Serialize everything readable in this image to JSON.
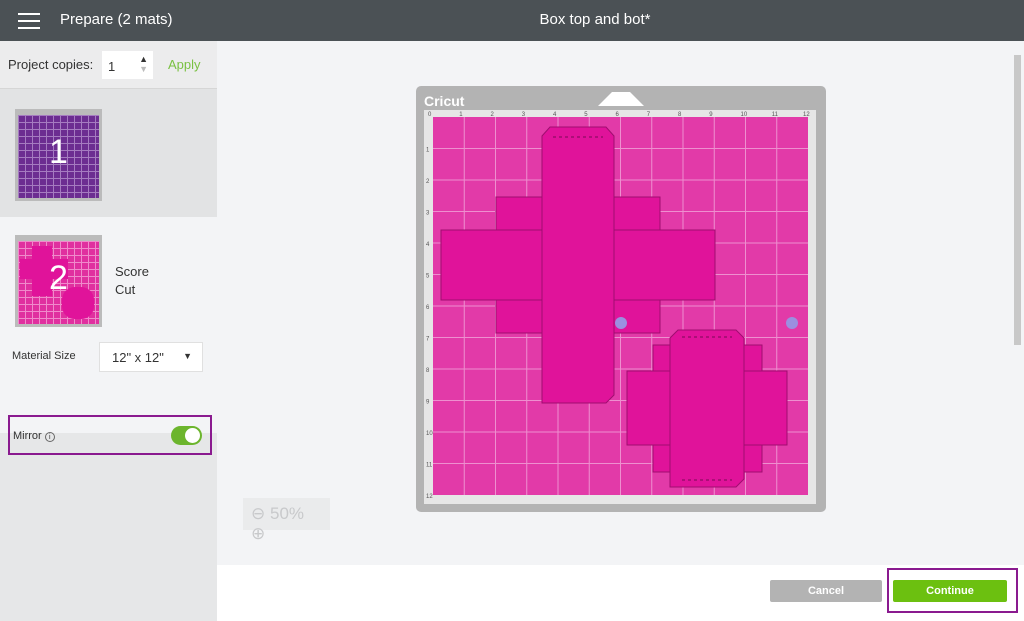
{
  "header": {
    "left_title": "Prepare (2 mats)",
    "doc_title": "Box top and bot*"
  },
  "sidebar": {
    "copies_label": "Project copies:",
    "copies_value": "1",
    "apply_label": "Apply",
    "mats": [
      {
        "number": "1",
        "color": "#6c2d91"
      },
      {
        "number": "2",
        "color": "#e0309f",
        "lines": [
          "Score",
          "Cut"
        ]
      }
    ],
    "material_size_label": "Material Size",
    "material_size_value": "12\" x 12\"",
    "mirror_label": "Mirror",
    "mirror_on": true
  },
  "canvas": {
    "brand": "Cricut",
    "ruler_top": [
      "0",
      "1",
      "2",
      "3",
      "4",
      "5",
      "6",
      "7",
      "8",
      "9",
      "10",
      "11",
      "12"
    ],
    "ruler_left": [
      "1",
      "2",
      "3",
      "4",
      "5",
      "6",
      "7",
      "8",
      "9",
      "10",
      "11",
      "12"
    ],
    "mat_color": "#e23aa8",
    "shape_color": "#e0139a",
    "zoom_level": "50%"
  },
  "footer": {
    "cancel_label": "Cancel",
    "continue_label": "Continue",
    "accent": "#6cc010"
  }
}
